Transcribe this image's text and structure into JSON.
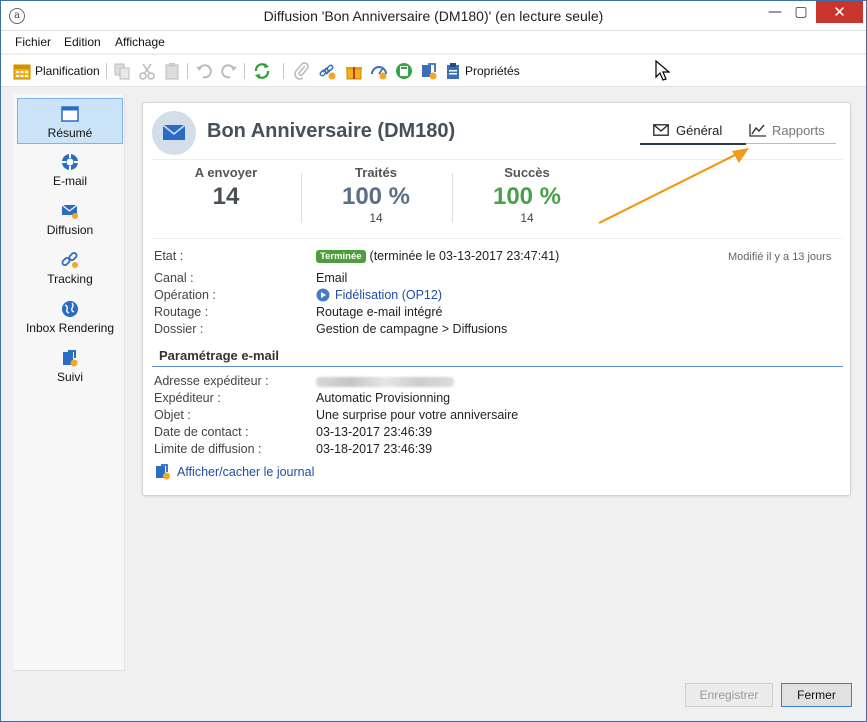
{
  "window": {
    "title": "Diffusion 'Bon Anniversaire (DM180)' (en lecture seule)",
    "app_icon_glyph": "a",
    "min_glyph": "—",
    "max_glyph": "▢",
    "close_glyph": "✕"
  },
  "menu": [
    "Fichier",
    "Edition",
    "Affichage"
  ],
  "toolbar": {
    "planification": "Planification",
    "proprietes": "Propriétés"
  },
  "nav": [
    {
      "label": "Résumé",
      "icon": "summary-icon",
      "active": true
    },
    {
      "label": "E-mail",
      "icon": "lifebuoy-icon",
      "active": false
    },
    {
      "label": "Diffusion",
      "icon": "delivery-icon",
      "active": false
    },
    {
      "label": "Tracking",
      "icon": "link-icon",
      "active": false
    },
    {
      "label": "Inbox Rendering",
      "icon": "globe-icon",
      "active": false
    },
    {
      "label": "Suivi",
      "icon": "tracking-info-icon",
      "active": false
    }
  ],
  "header": {
    "title": "Bon Anniversaire (DM180)",
    "tab_general": "Général",
    "tab_rapports": "Rapports"
  },
  "stats": [
    {
      "label": "A envoyer",
      "value": "14",
      "sub": "",
      "color": "#4a4f55"
    },
    {
      "label": "Traités",
      "value": "100 %",
      "sub": "14",
      "color": "#5b6f86"
    },
    {
      "label": "Succès",
      "value": "100 %",
      "sub": "14",
      "color": "#4aa04a"
    }
  ],
  "details": {
    "etat_label": "Etat :",
    "etat_badge": "Terminée",
    "etat_text": "(terminée le 03-13-2017 23:47:41)",
    "modified": "Modifié il y a 13 jours",
    "canal_label": "Canal :",
    "canal_value": "Email",
    "operation_label": "Opération :",
    "operation_value": "Fidélisation (OP12)",
    "routage_label": "Routage :",
    "routage_value": "Routage e-mail intégré",
    "dossier_label": "Dossier :",
    "dossier_value": "Gestion de campagne > Diffusions"
  },
  "email_params": {
    "section_title": "Paramétrage e-mail",
    "adresse_label": "Adresse expéditeur :",
    "expediteur_label": "Expéditeur :",
    "expediteur_value": "Automatic Provisionning",
    "objet_label": "Objet :",
    "objet_value": "Une surprise pour votre anniversaire",
    "date_contact_label": "Date de contact :",
    "date_contact_value": "03-13-2017 23:46:39",
    "limite_label": "Limite de diffusion :",
    "limite_value": "03-18-2017 23:46:39"
  },
  "journal_link": "Afficher/cacher le journal",
  "buttons": {
    "save": "Enregistrer",
    "close": "Fermer"
  },
  "colors": {
    "accent": "#1f4ea6",
    "success": "#4aa04a",
    "badge": "#4e9e3e",
    "annotation_arrow": "#f39a1b"
  }
}
